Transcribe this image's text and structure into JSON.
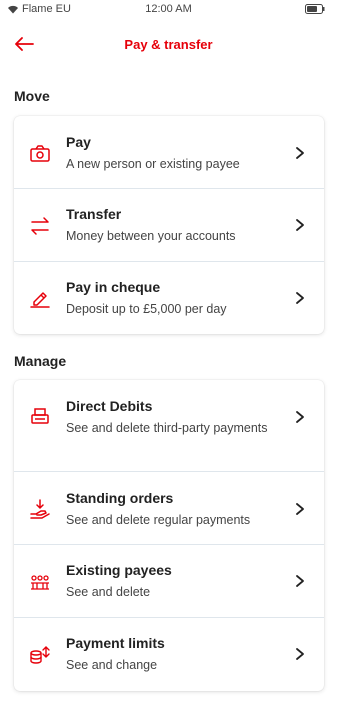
{
  "status": {
    "carrier": "Flame EU",
    "time": "12:00 AM"
  },
  "header": {
    "title": "Pay & transfer"
  },
  "sections": [
    {
      "title": "Move",
      "items": [
        {
          "label": "Pay",
          "subtitle": "A new person or existing payee",
          "icon": "pay-camera-icon"
        },
        {
          "label": "Transfer",
          "subtitle": "Money between your accounts",
          "icon": "transfer-arrows-icon"
        },
        {
          "label": "Pay in cheque",
          "subtitle": "Deposit up to £5,000 per day",
          "icon": "cheque-pen-icon"
        }
      ]
    },
    {
      "title": "Manage",
      "items": [
        {
          "label": "Direct Debits",
          "subtitle": "See and delete third-party payments",
          "icon": "direct-debit-icon"
        },
        {
          "label": "Standing orders",
          "subtitle": "See and delete regular payments",
          "icon": "standing-order-icon"
        },
        {
          "label": "Existing payees",
          "subtitle": "See and delete",
          "icon": "payees-icon"
        },
        {
          "label": "Payment limits",
          "subtitle": "See and change",
          "icon": "payment-limits-icon"
        }
      ]
    }
  ],
  "colors": {
    "accent": "#e6000a",
    "text": "#222222",
    "divider": "#dfe6ec"
  }
}
